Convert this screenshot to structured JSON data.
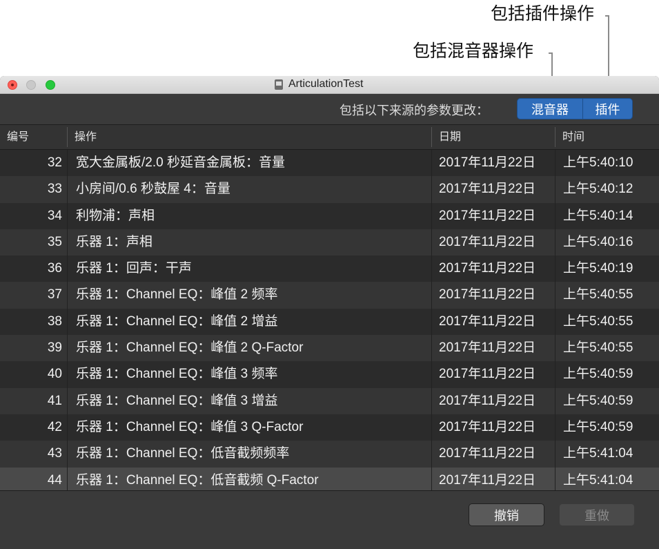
{
  "callouts": {
    "plugins": "包括插件操作",
    "mixer": "包括混音器操作"
  },
  "window": {
    "title": "ArticulationTest"
  },
  "filter": {
    "label": "包括以下来源的参数更改：",
    "mixer_label": "混音器",
    "plugins_label": "插件"
  },
  "columns": {
    "num": "编号",
    "op": "操作",
    "date": "日期",
    "time": "时间"
  },
  "rows": [
    {
      "num": "32",
      "op": "宽大金属板/2.0 秒延音金属板：音量",
      "date": "2017年11月22日",
      "time": "上午5:40:10"
    },
    {
      "num": "33",
      "op": "小房间/0.6 秒鼓屋 4：音量",
      "date": "2017年11月22日",
      "time": "上午5:40:12"
    },
    {
      "num": "34",
      "op": "利物浦：声相",
      "date": "2017年11月22日",
      "time": "上午5:40:14"
    },
    {
      "num": "35",
      "op": "乐器 1：声相",
      "date": "2017年11月22日",
      "time": "上午5:40:16"
    },
    {
      "num": "36",
      "op": "乐器 1：回声：干声",
      "date": "2017年11月22日",
      "time": "上午5:40:19"
    },
    {
      "num": "37",
      "op": "乐器 1：Channel EQ：峰值 2 频率",
      "date": "2017年11月22日",
      "time": "上午5:40:55"
    },
    {
      "num": "38",
      "op": "乐器 1：Channel EQ：峰值 2 增益",
      "date": "2017年11月22日",
      "time": "上午5:40:55"
    },
    {
      "num": "39",
      "op": "乐器 1：Channel EQ：峰值 2 Q-Factor",
      "date": "2017年11月22日",
      "time": "上午5:40:55"
    },
    {
      "num": "40",
      "op": "乐器 1：Channel EQ：峰值 3 频率",
      "date": "2017年11月22日",
      "time": "上午5:40:59"
    },
    {
      "num": "41",
      "op": "乐器 1：Channel EQ：峰值 3 增益",
      "date": "2017年11月22日",
      "time": "上午5:40:59"
    },
    {
      "num": "42",
      "op": "乐器 1：Channel EQ：峰值 3 Q-Factor",
      "date": "2017年11月22日",
      "time": "上午5:40:59"
    },
    {
      "num": "43",
      "op": "乐器 1：Channel EQ：低音截频频率",
      "date": "2017年11月22日",
      "time": "上午5:41:04"
    },
    {
      "num": "44",
      "op": "乐器 1：Channel EQ：低音截频 Q-Factor",
      "date": "2017年11月22日",
      "time": "上午5:41:04"
    }
  ],
  "selected_row": "44",
  "buttons": {
    "undo": "撤销",
    "redo": "重做"
  },
  "colors": {
    "segment_active": "#2f6dbb",
    "window_bg": "#323232"
  }
}
